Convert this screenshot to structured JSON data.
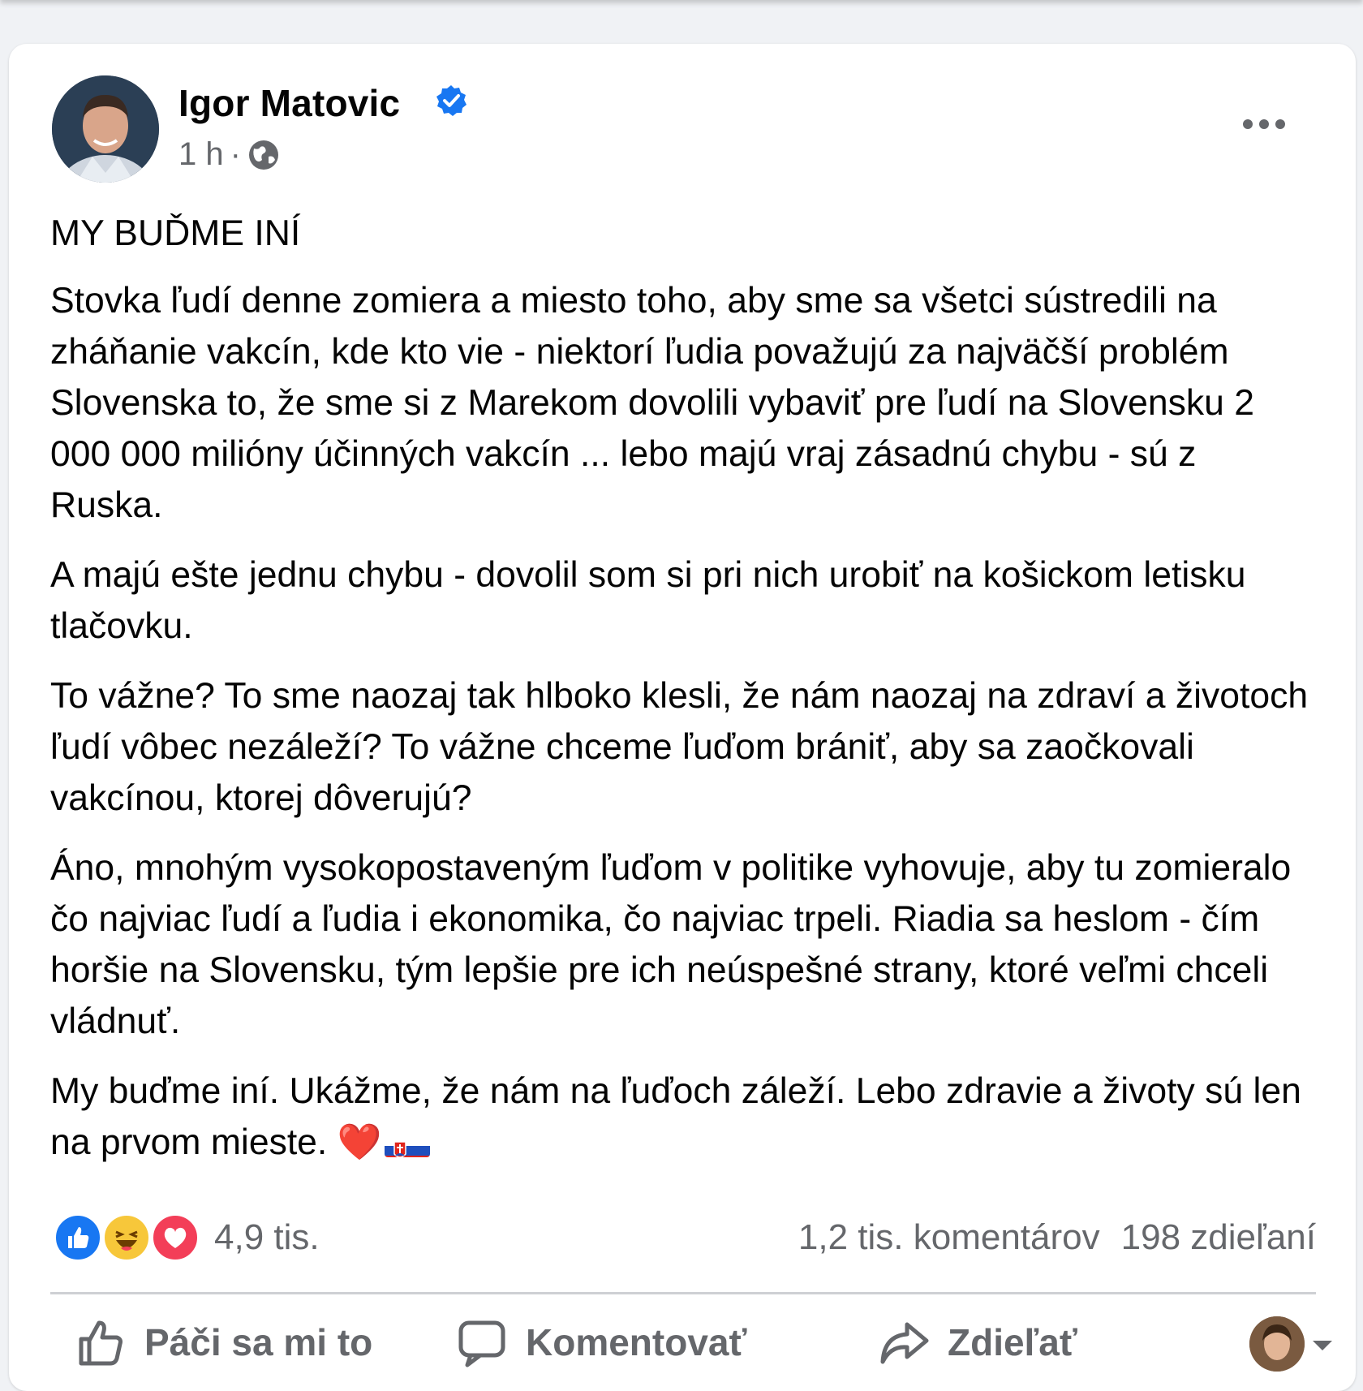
{
  "post": {
    "author": "Igor Matovic",
    "time": "1 h",
    "separator": "·",
    "title": "MY BUĎME INÍ",
    "paragraphs": [
      "Stovka ľudí denne zomiera a miesto toho, aby sme sa všetci sústredili na zháňanie vakcín, kde kto vie - niektorí ľudia považujú za najväčší problém Slovenska to, že sme si z Marekom dovolili vybaviť pre ľudí na Slovensku 2 000 000 milióny účinných vakcín ... lebo majú vraj zásadnú chybu - sú z Ruska.",
      "A majú ešte jednu chybu - dovolil som si pri nich urobiť na košickom letisku tlačovku.",
      "To vážne? To sme naozaj tak hlboko klesli, že nám naozaj na zdraví a životoch ľudí vôbec nezáleží? To vážne chceme ľuďom brániť, aby sa zaočkovali vakcínou, ktorej dôverujú?",
      "Áno, mnohým vysokopostaveným ľuďom v politike vyhovuje, aby tu zomieralo čo najviac ľudí a ľudia i ekonomika, čo najviac trpeli. Riadia sa heslom - čím horšie na Slovensku, tým lepšie pre ich neúspešné strany, ktoré veľmi chceli vládnuť."
    ],
    "closing": "My buďme iní. Ukážme, že nám na ľuďoch záleží. Lebo zdravie a životy sú len na prvom mieste.",
    "closing_emoji": "❤️"
  },
  "stats": {
    "reactions_count": "4,9 tis.",
    "comments": "1,2 tis. komentárov",
    "shares": "198 zdieľaní"
  },
  "actions": {
    "like": "Páči sa mi to",
    "comment": "Komentovať",
    "share": "Zdieľať"
  },
  "colors": {
    "brand_blue": "#1877f2",
    "secondary_text": "#65676b",
    "love_red": "#f33e58",
    "haha_yellow": "#f7c73a"
  },
  "icons": [
    "verified-badge-icon",
    "globe-icon",
    "more-options-icon",
    "like-reaction-icon",
    "haha-reaction-icon",
    "love-reaction-icon",
    "thumbs-up-icon",
    "comment-icon",
    "share-icon",
    "slovak-flag-icon"
  ]
}
